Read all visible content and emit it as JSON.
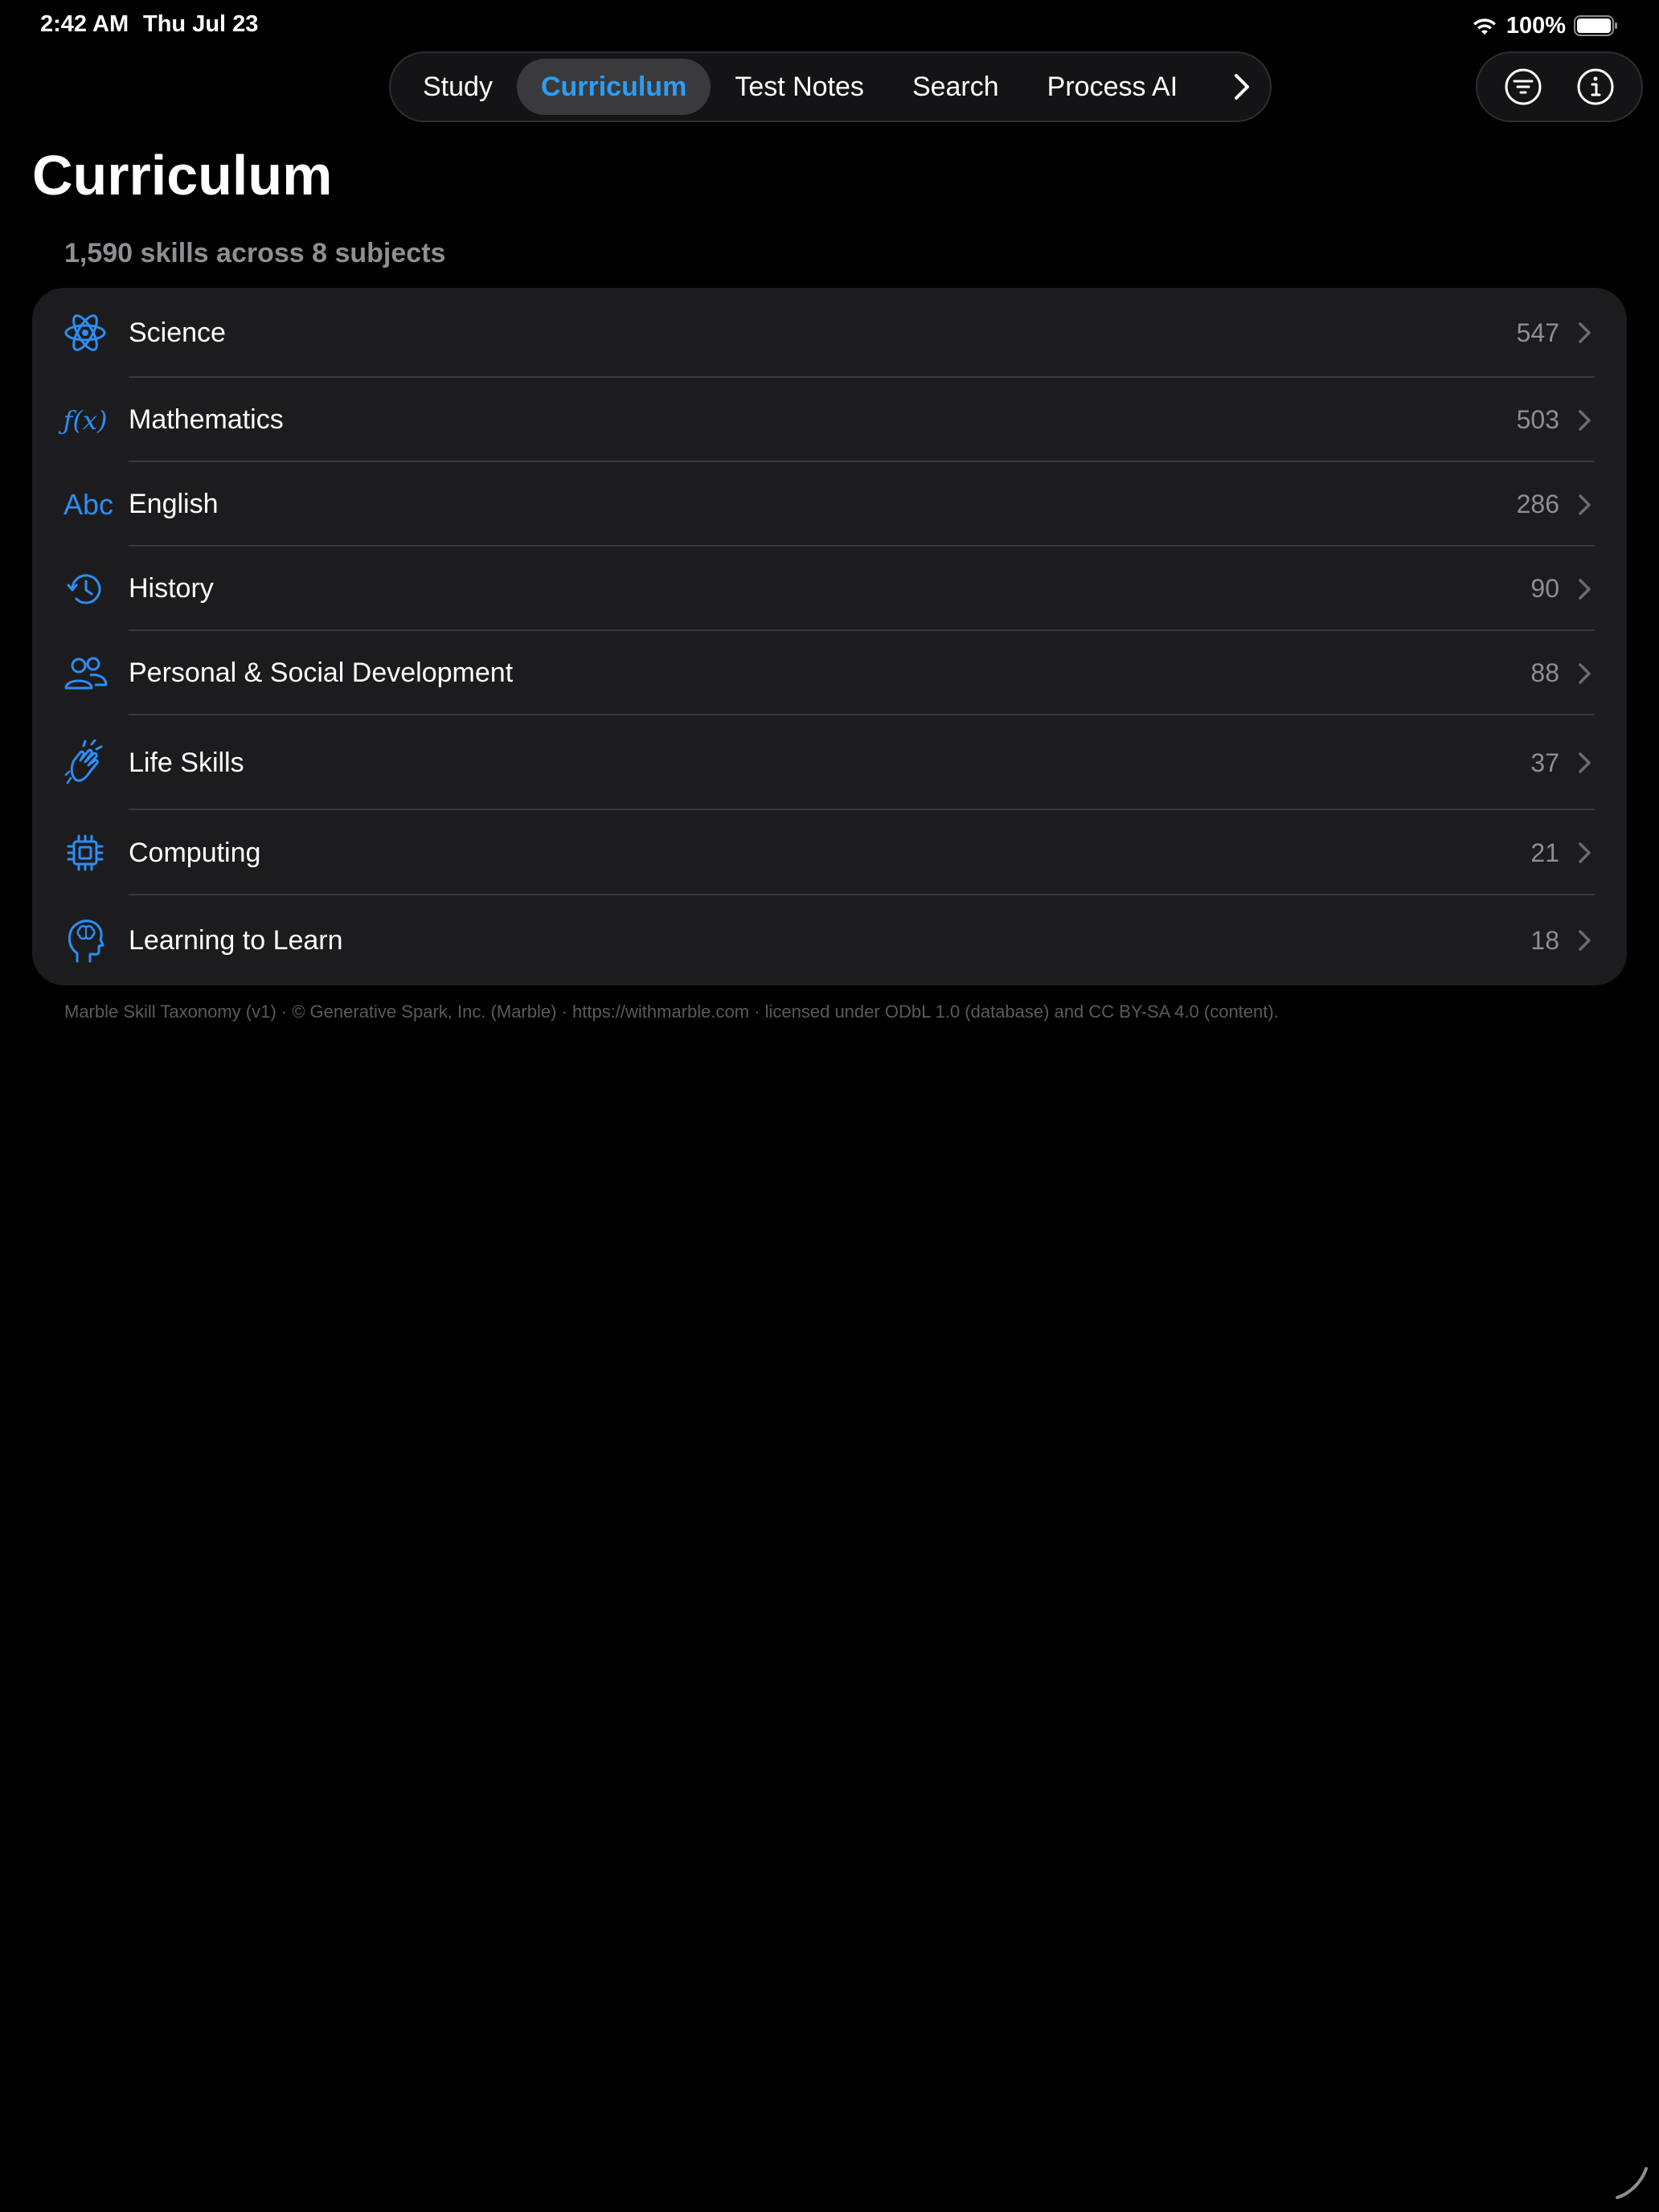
{
  "status_bar": {
    "time": "2:42 AM",
    "date": "Thu Jul 23",
    "battery_percent": "100%"
  },
  "tabs": [
    {
      "label": "Study",
      "active": false
    },
    {
      "label": "Curriculum",
      "active": true
    },
    {
      "label": "Test Notes",
      "active": false
    },
    {
      "label": "Search",
      "active": false
    },
    {
      "label": "Process AI",
      "active": false
    }
  ],
  "page": {
    "title": "Curriculum",
    "subtitle": "1,590 skills across 8 subjects"
  },
  "subjects": [
    {
      "label": "Science",
      "count": "547",
      "icon": "atom-icon"
    },
    {
      "label": "Mathematics",
      "count": "503",
      "icon": "function-icon",
      "icon_text": "ƒ(x)"
    },
    {
      "label": "English",
      "count": "286",
      "icon": "abc-text-icon",
      "icon_text": "Abc"
    },
    {
      "label": "History",
      "count": "90",
      "icon": "clock-history-icon"
    },
    {
      "label": "Personal & Social Development",
      "count": "88",
      "icon": "people-icon"
    },
    {
      "label": "Life Skills",
      "count": "37",
      "icon": "hands-clap-icon"
    },
    {
      "label": "Computing",
      "count": "21",
      "icon": "cpu-chip-icon"
    },
    {
      "label": "Learning to Learn",
      "count": "18",
      "icon": "brain-head-icon"
    }
  ],
  "footer": {
    "attribution": "Marble Skill Taxonomy (v1) · © Generative Spark, Inc. (Marble) · https://withmarble.com · licensed under ODbL 1.0 (database) and CC BY-SA 4.0 (content)."
  },
  "colors": {
    "accent": "#2c9df5",
    "icon_blue": "#2c8ef4",
    "card_bg": "#1c1c1e",
    "background": "#000000",
    "secondary_text": "#8e8e93"
  }
}
